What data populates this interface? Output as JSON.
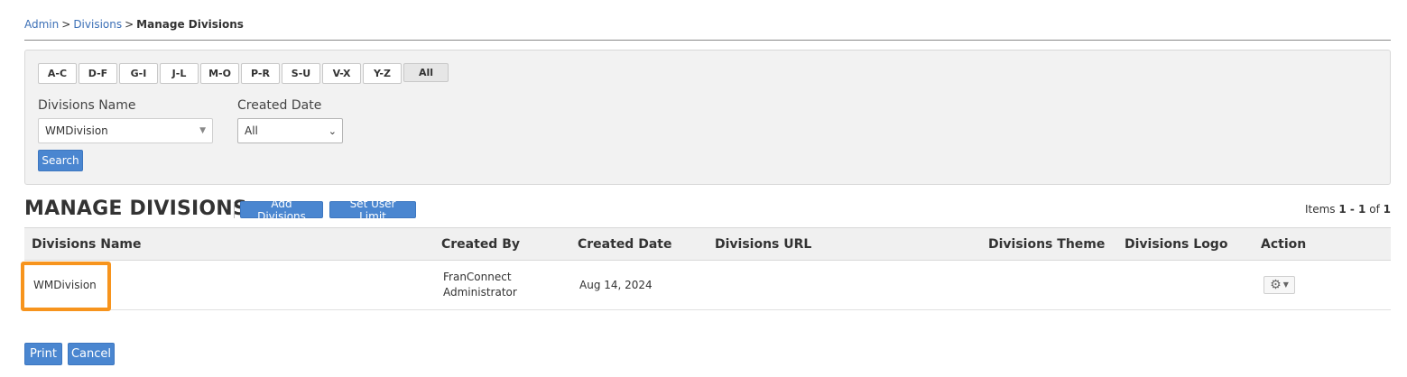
{
  "breadcrumb": {
    "items": [
      "Admin",
      "Divisions"
    ],
    "separator": ">",
    "current": "Manage Divisions"
  },
  "filters": {
    "alphabet": [
      "A-C",
      "D-F",
      "G-I",
      "J-L",
      "M-O",
      "P-R",
      "S-U",
      "V-X",
      "Y-Z",
      "All"
    ],
    "divisions_name_label": "Divisions Name",
    "divisions_name_value": "WMDivision",
    "created_date_label": "Created Date",
    "created_date_value": "All",
    "search_label": "Search"
  },
  "section": {
    "title": "MANAGE DIVISIONS",
    "add_label": "Add Divisions",
    "limit_label": "Set User Limit",
    "items_prefix": "Items",
    "items_range": "1 - 1",
    "items_of": "of",
    "items_total": "1"
  },
  "table": {
    "columns": [
      "Divisions Name",
      "Created By",
      "Created Date",
      "Divisions URL",
      "Divisions Theme",
      "Divisions Logo",
      "Action"
    ],
    "rows": [
      {
        "name": "WMDivision",
        "created_by_line1": "FranConnect",
        "created_by_line2": "Administrator",
        "created_date": "Aug 14, 2024",
        "url": "",
        "theme": "",
        "logo": ""
      }
    ]
  },
  "footer": {
    "print_label": "Print",
    "cancel_label": "Cancel"
  },
  "colors": {
    "accent": "#4a86d0",
    "highlight": "#f7941d",
    "link": "#3b6fb6"
  }
}
